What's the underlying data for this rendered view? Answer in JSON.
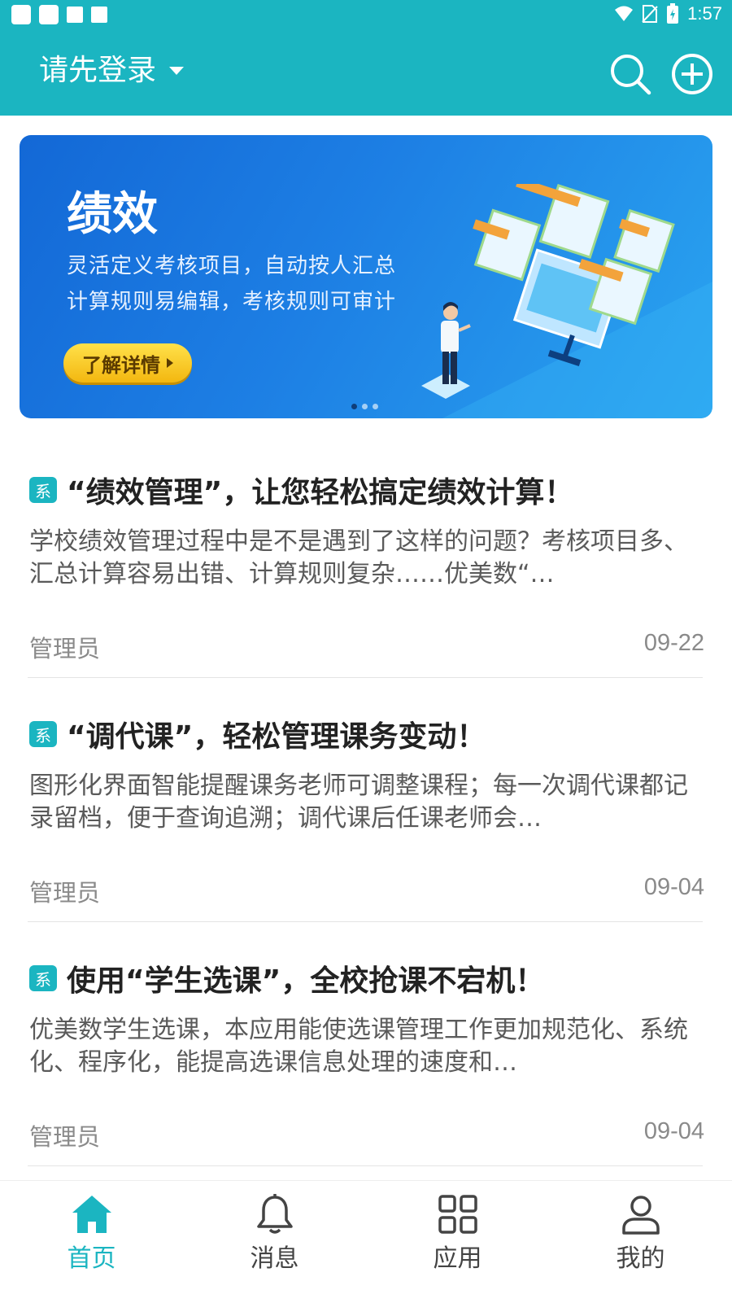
{
  "status_bar": {
    "time": "1:57"
  },
  "app_bar": {
    "title": "请先登录"
  },
  "banner": {
    "title": "绩效",
    "line1": "灵活定义考核项目，自动按人汇总",
    "line2": "计算规则易编辑，考核规则可审计",
    "button_label": "了解详情",
    "page_count": 3,
    "active_page": 1
  },
  "articles": [
    {
      "badge": "系",
      "title": "“绩效管理”，让您轻松搞定绩效计算！",
      "summary": "学校绩效管理过程中是不是遇到了这样的问题？考核项目多、汇总计算容易出错、计算规则复杂……优美数“…",
      "author": "管理员",
      "date": "09-22"
    },
    {
      "badge": "系",
      "title": "“调代课”，轻松管理课务变动！",
      "summary": "图形化界面智能提醒课务老师可调整课程；每一次调代课都记录留档，便于查询追溯；调代课后任课老师会…",
      "author": "管理员",
      "date": "09-04"
    },
    {
      "badge": "系",
      "title": "使用“学生选课”，全校抢课不宕机！",
      "summary": "优美数学生选课，本应用能使选课管理工作更加规范化、系统化、程序化，能提高选课信息处理的速度和…",
      "author": "管理员",
      "date": "09-04"
    }
  ],
  "bottom_nav": [
    {
      "label": "首页",
      "icon": "home-icon",
      "active": true
    },
    {
      "label": "消息",
      "icon": "bell-icon",
      "active": false
    },
    {
      "label": "应用",
      "icon": "apps-grid-icon",
      "active": false
    },
    {
      "label": "我的",
      "icon": "profile-icon",
      "active": false
    }
  ],
  "colors": {
    "brand": "#1bb5c1",
    "banner": "#1d7fe4",
    "button": "#f3b710"
  }
}
